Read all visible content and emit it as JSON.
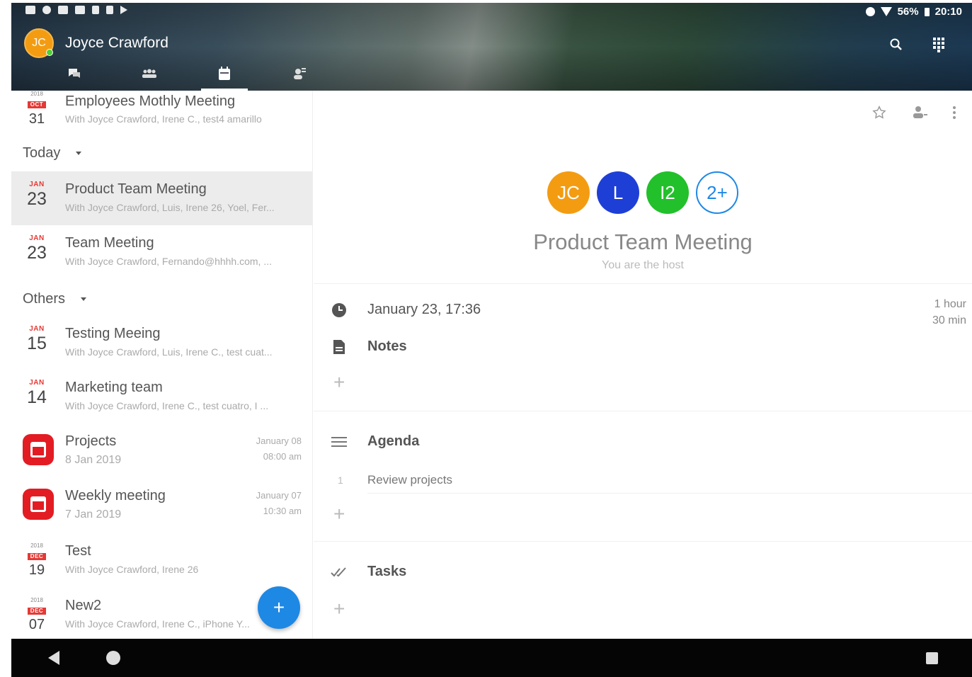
{
  "status_bar": {
    "battery": "56%",
    "time": "20:10"
  },
  "header": {
    "avatar_initials": "JC",
    "user_name": "Joyce Crawford",
    "tabs": [
      "chat-icon",
      "team-icon",
      "calendar-icon",
      "contacts-icon"
    ],
    "actions": [
      "search-icon",
      "dialpad-icon"
    ]
  },
  "list": {
    "top_item": {
      "year": "2018",
      "month": "OCT",
      "day": "31",
      "title": "Employees Mothly Meeting",
      "subtitle": "With Joyce Crawford, Irene C., test4 amarillo"
    },
    "sections": {
      "today": "Today",
      "others": "Others"
    },
    "today_items": [
      {
        "month": "JAN",
        "day": "23",
        "title": "Product Team Meeting",
        "subtitle": "With Joyce Crawford, Luis, Irene 26, Yoel, Fer..."
      },
      {
        "month": "JAN",
        "day": "23",
        "title": "Team Meeting",
        "subtitle": "With Joyce Crawford, Fernando@hhhh.com, ..."
      }
    ],
    "other_items": [
      {
        "month": "JAN",
        "day": "15",
        "title": "Testing Meeing",
        "subtitle": "With Joyce Crawford, Luis, Irene C., test cuat..."
      },
      {
        "month": "JAN",
        "day": "14",
        "title": "Marketing team",
        "subtitle": "With Joyce Crawford, Irene C., test cuatro, I ..."
      }
    ],
    "app_items": [
      {
        "title": "Projects",
        "subtitle": "8 Jan 2019",
        "date": "January 08",
        "time": "08:00 am"
      },
      {
        "title": "Weekly meeting",
        "subtitle": "7 Jan 2019",
        "date": "January 07",
        "time": "10:30 am"
      }
    ],
    "tail_items": [
      {
        "year": "2018",
        "month": "DEC",
        "day": "19",
        "title": "Test",
        "subtitle": "With Joyce Crawford, Irene 26"
      },
      {
        "year": "2018",
        "month": "DEC",
        "day": "07",
        "title": "New2",
        "subtitle": "With Joyce Crawford, Irene C., iPhone Y..."
      }
    ],
    "fab_label": "+"
  },
  "detail": {
    "participants": [
      {
        "initials": "JC",
        "color": "#f39c12"
      },
      {
        "initials": "L",
        "color": "#1e3fd6"
      },
      {
        "initials": "I2",
        "color": "#22c02b"
      },
      {
        "initials": "2+",
        "color": "#1e88e5"
      }
    ],
    "title": "Product Team Meeting",
    "subtitle": "You are the host",
    "datetime": "January 23, 17:36",
    "duration_line1": "1 hour",
    "duration_line2": "30 min",
    "notes_label": "Notes",
    "agenda_label": "Agenda",
    "agenda_items": [
      {
        "num": "1",
        "text": "Review projects"
      }
    ],
    "tasks_label": "Tasks",
    "add_label": "+"
  },
  "colors": {
    "accent": "#1e88e5",
    "app_red": "#e31c23",
    "date_red": "#e53935"
  }
}
